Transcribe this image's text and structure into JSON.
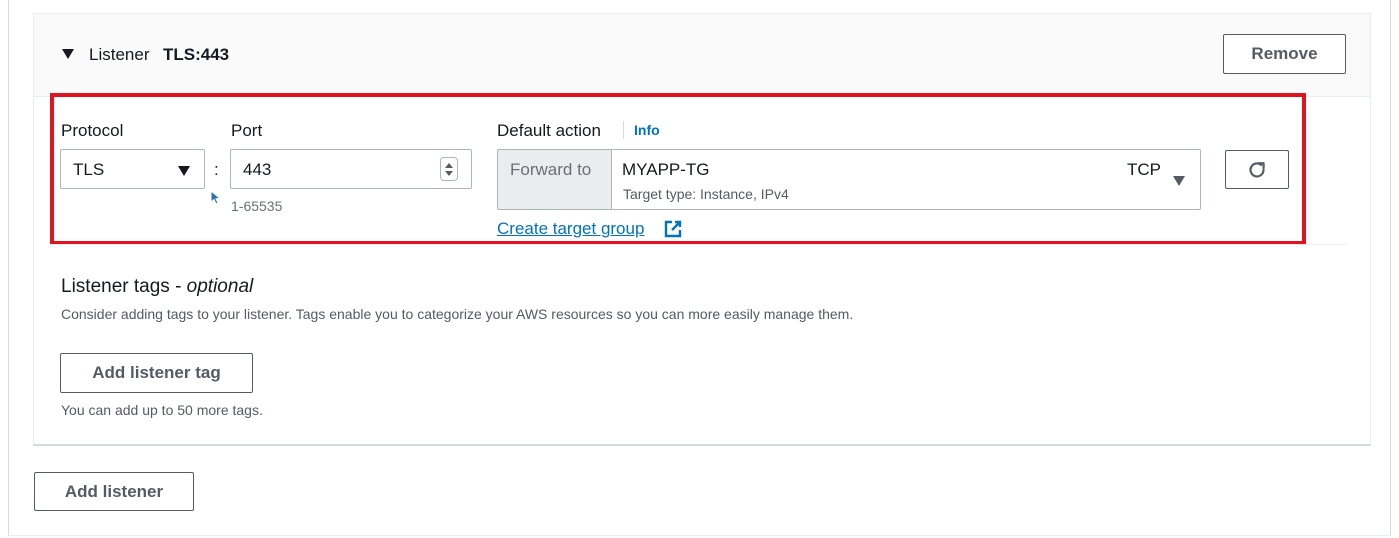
{
  "listener": {
    "label": "Listener",
    "name": "TLS:443",
    "remove_label": "Remove"
  },
  "protocol": {
    "label": "Protocol",
    "value": "TLS"
  },
  "port": {
    "label": "Port",
    "value": "443",
    "hint": "1-65535"
  },
  "default_action": {
    "label": "Default action",
    "info_label": "Info",
    "prefix": "Forward to",
    "target_group_name": "MYAPP-TG",
    "target_type": "Target type: Instance, IPv4",
    "target_protocol": "TCP",
    "create_link": "Create target group"
  },
  "tags": {
    "title": "Listener tags - ",
    "title_optional": "optional",
    "description": "Consider adding tags to your listener. Tags enable you to categorize your AWS resources so you can more easily manage them.",
    "add_label": "Add listener tag",
    "limit_text": "You can add up to 50 more tags."
  },
  "footer": {
    "add_listener_label": "Add listener"
  },
  "colors": {
    "highlight": "#e0141e",
    "link": "#0073bb"
  },
  "icons": {
    "expand": "caret-down-icon",
    "dropdown": "triangle-down-icon",
    "stepper": "stepper-icon",
    "refresh": "refresh-icon",
    "external": "external-link-icon",
    "cursor": "mouse-cursor-icon"
  }
}
